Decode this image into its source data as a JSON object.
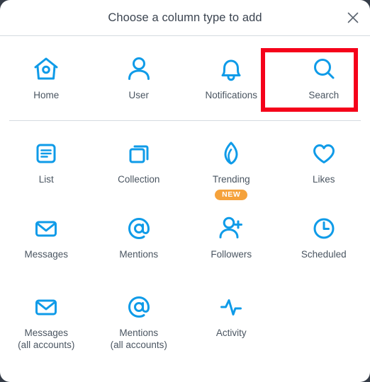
{
  "window": {
    "backdrop_color": "#353c47",
    "surface_color": "#ffffff"
  },
  "header": {
    "title": "Choose a column type to add",
    "close_icon": "close-icon"
  },
  "theme": {
    "icon_blue": "#0f9be8",
    "label_gray": "#4a5561",
    "divider_gray": "#d4dbe0",
    "badge_orange": "#f5a23c",
    "highlight_red": "#f5021a"
  },
  "highlight": {
    "target": "Search",
    "color": "#f5021a",
    "border_width": 6
  },
  "grid": {
    "rows": [
      {
        "items": [
          {
            "label": "Home",
            "sublabel": "",
            "icon": "home-icon",
            "badge": ""
          },
          {
            "label": "User",
            "sublabel": "",
            "icon": "user-icon",
            "badge": ""
          },
          {
            "label": "Notifications",
            "sublabel": "",
            "icon": "bell-icon",
            "badge": ""
          },
          {
            "label": "Search",
            "sublabel": "",
            "icon": "search-icon",
            "badge": ""
          }
        ]
      },
      {
        "items": [
          {
            "label": "List",
            "sublabel": "",
            "icon": "list-icon",
            "badge": ""
          },
          {
            "label": "Collection",
            "sublabel": "",
            "icon": "collection-icon",
            "badge": ""
          },
          {
            "label": "Trending",
            "sublabel": "",
            "icon": "flame-icon",
            "badge": "NEW"
          },
          {
            "label": "Likes",
            "sublabel": "",
            "icon": "heart-icon",
            "badge": ""
          }
        ]
      },
      {
        "items": [
          {
            "label": "Messages",
            "sublabel": "",
            "icon": "envelope-icon",
            "badge": ""
          },
          {
            "label": "Mentions",
            "sublabel": "",
            "icon": "at-sign-icon",
            "badge": ""
          },
          {
            "label": "Followers",
            "sublabel": "",
            "icon": "user-plus-icon",
            "badge": ""
          },
          {
            "label": "Scheduled",
            "sublabel": "",
            "icon": "clock-icon",
            "badge": ""
          }
        ]
      },
      {
        "items": [
          {
            "label": "Messages",
            "sublabel": "(all accounts)",
            "icon": "envelope-icon",
            "badge": ""
          },
          {
            "label": "Mentions",
            "sublabel": "(all accounts)",
            "icon": "at-sign-icon",
            "badge": ""
          },
          {
            "label": "Activity",
            "sublabel": "",
            "icon": "activity-pulse-icon",
            "badge": ""
          },
          {
            "label": "",
            "sublabel": "",
            "icon": "",
            "badge": ""
          }
        ]
      }
    ]
  }
}
